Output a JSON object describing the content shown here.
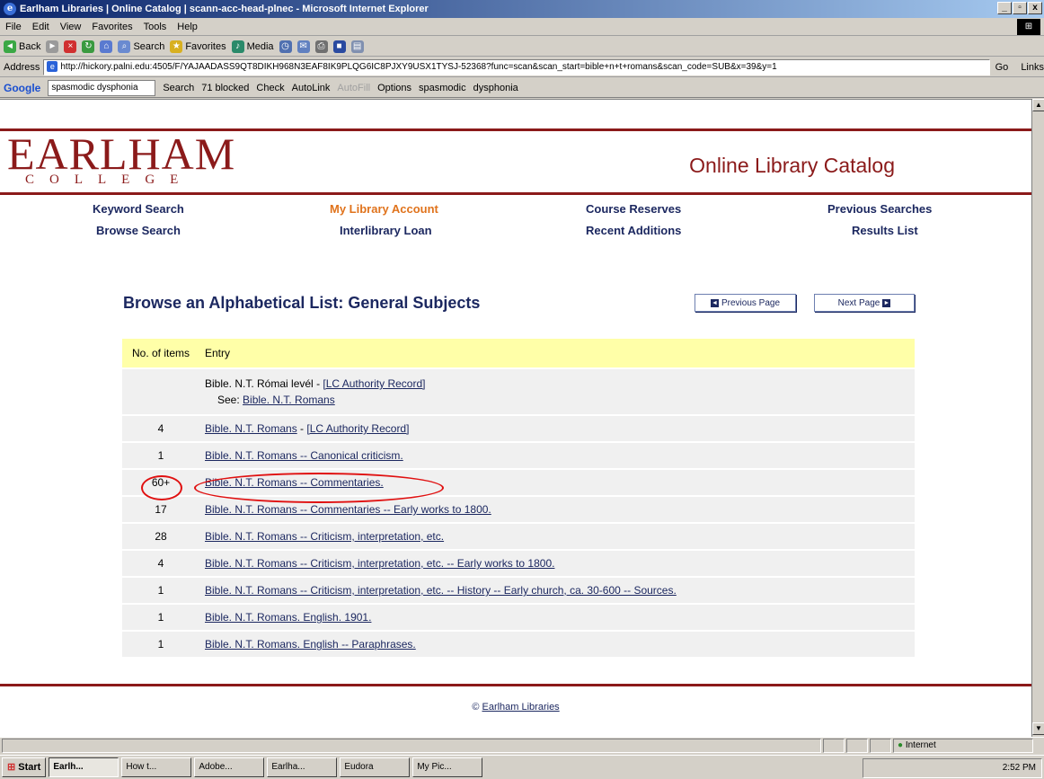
{
  "window": {
    "title": "Earlham Libraries | Online Catalog | scann-acc-head-plnec - Microsoft Internet Explorer",
    "min": "_",
    "max": "▫",
    "close": "x"
  },
  "menu": [
    "File",
    "Edit",
    "View",
    "Favorites",
    "Tools",
    "Help"
  ],
  "toolbar": {
    "back": "Back",
    "search": "Search",
    "favorites": "Favorites",
    "media": "Media"
  },
  "address": {
    "label": "Address",
    "url": "http://hickory.palni.edu:4505/F/YAJAADASS9QT8DIKH968N3EAF8IK9PLQG6IC8PJXY9USX1TYSJ-52368?func=scan&scan_start=bible+n+t+romans&scan_code=SUB&x=39&y=1",
    "go": "Go",
    "links": "Links"
  },
  "googlebar": {
    "logo": "Google",
    "query": "spasmodic dysphonia",
    "search": "Search",
    "blocked": "71 blocked",
    "check": "Check",
    "autolink": "AutoLink",
    "autofill": "AutoFill",
    "options": "Options",
    "term1": "spasmodic",
    "term2": "dysphonia"
  },
  "brand": {
    "name": "EARLHAM",
    "sub": "COLLEGE",
    "catalog": "Online Library Catalog"
  },
  "nav": {
    "keyword": "Keyword Search",
    "account": "My Library Account",
    "reserves": "Course Reserves",
    "previous_searches": "Previous Searches",
    "browse": "Browse Search",
    "ill": "Interlibrary Loan",
    "recent": "Recent Additions",
    "results": "Results List"
  },
  "heading": "Browse an Alphabetical List: General Subjects",
  "paging": {
    "prev": "Previous Page",
    "next": "Next Page"
  },
  "table": {
    "col_count": "No. of items",
    "col_entry": "Entry",
    "first": {
      "count": "",
      "entry": "Bible. N.T. Római levél",
      "authority": "[LC Authority Record]",
      "see_label": "See:",
      "see_link": "Bible. N.T. Romans"
    },
    "rows": [
      {
        "count": "4",
        "entry": "Bible. N.T. Romans",
        "authority": "[LC Authority Record]"
      },
      {
        "count": "1",
        "entry": "Bible. N.T. Romans -- Canonical criticism.",
        "authority": ""
      },
      {
        "count": "60+",
        "entry": "Bible. N.T. Romans -- Commentaries.",
        "authority": ""
      },
      {
        "count": "17",
        "entry": "Bible. N.T. Romans -- Commentaries -- Early works to 1800.",
        "authority": ""
      },
      {
        "count": "28",
        "entry": "Bible. N.T. Romans -- Criticism, interpretation, etc.",
        "authority": ""
      },
      {
        "count": "4",
        "entry": "Bible. N.T. Romans -- Criticism, interpretation, etc. -- Early works to 1800.",
        "authority": ""
      },
      {
        "count": "1",
        "entry": "Bible. N.T. Romans -- Criticism, interpretation, etc. -- History -- Early church, ca. 30-600 -- Sources.",
        "authority": ""
      },
      {
        "count": "1",
        "entry": "Bible. N.T. Romans. English. 1901.",
        "authority": ""
      },
      {
        "count": "1",
        "entry": "Bible. N.T. Romans. English -- Paraphrases.",
        "authority": ""
      }
    ]
  },
  "footer": {
    "copy": "©",
    "link": "Earlham Libraries"
  },
  "status": {
    "zone": "Internet"
  },
  "taskbar": {
    "start": "Start",
    "tasks": [
      "Earlh...",
      "How t...",
      "Adobe...",
      "Earlha...",
      "Eudora",
      "My Pic..."
    ],
    "clock": "2:52 PM"
  },
  "colors": {
    "brand": "#8b1a1a",
    "link": "#1c2860",
    "current": "#e0731c",
    "header_row": "#ffffa8",
    "annotation": "#e01010"
  }
}
